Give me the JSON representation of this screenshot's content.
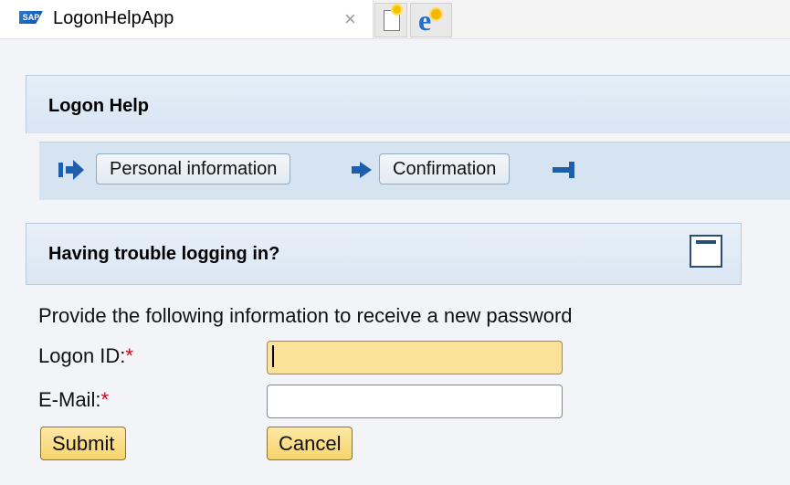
{
  "browser": {
    "tab_title": "LogonHelpApp",
    "tab_logo_text": "SAP",
    "close_symbol": "×",
    "icons": [
      "sap-logo-icon",
      "close-icon",
      "new-tab-icon",
      "internet-explorer-icon"
    ]
  },
  "header": {
    "title": "Logon Help"
  },
  "roadmap": {
    "steps": [
      {
        "label": "Personal information"
      },
      {
        "label": "Confirmation"
      }
    ],
    "accent_color": "#1d5fab"
  },
  "panel": {
    "title": "Having trouble logging in?"
  },
  "form": {
    "intro": "Provide the following information to receive a new password",
    "logon_id_label": "Logon ID:",
    "logon_id_value": "",
    "email_label": "E-Mail:",
    "email_value": "",
    "required_marker": "*",
    "submit_label": "Submit",
    "cancel_label": "Cancel"
  }
}
